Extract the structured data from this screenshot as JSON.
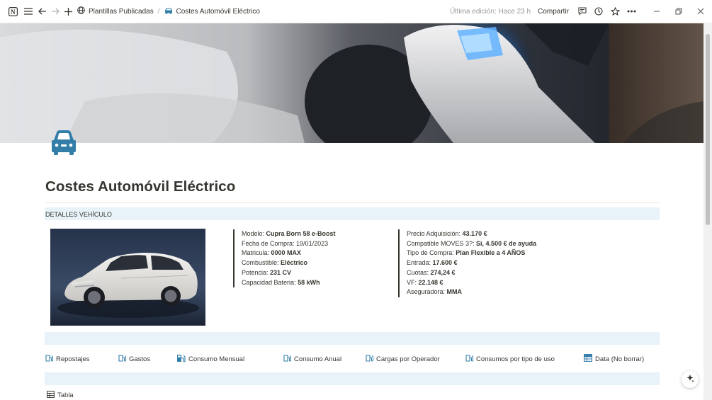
{
  "topbar": {
    "breadcrumb_parent": "Plantillas Publicadas",
    "breadcrumb_current": "Costes Automóvil Eléctrico",
    "last_edited": "Última edición: Hace 23 h",
    "share_label": "Compartir"
  },
  "page": {
    "title": "Costes Automóvil Eléctrico",
    "section_title": "DETALLES VEHÍCULO"
  },
  "vehicle": [
    {
      "label": "Modelo: ",
      "value": "Cupra Born 58 e-Boost"
    },
    {
      "label": "Fecha de Compra: ",
      "value": "19/01/2023"
    },
    {
      "label": "Matricula: ",
      "value": "0000 MAX"
    },
    {
      "label": "Combustible: ",
      "value": "Eléctrico"
    },
    {
      "label": "Potencia: ",
      "value": "231 CV"
    },
    {
      "label": "Capacidad Bateria: ",
      "value": "58 kWh"
    }
  ],
  "finance": [
    {
      "label": "Precio Adquisición: ",
      "value": "43.170 €"
    },
    {
      "label": "Compatible MOVES 3?: ",
      "value": "Si, 4.500 € de ayuda"
    },
    {
      "label": "Tipo de Compra: ",
      "value": "Plan Flexible a 4 AÑOS"
    },
    {
      "label": "Entrada: ",
      "value": "17.600 €"
    },
    {
      "label": "Cuotas: ",
      "value": "274,24 €"
    },
    {
      "label": "VF: ",
      "value": "22.148 €"
    },
    {
      "label": "Aseguradora: ",
      "value": "MMA"
    }
  ],
  "tabs": [
    {
      "label": "Repostajes",
      "icon": "gas-pump-icon"
    },
    {
      "label": "Gastos",
      "icon": "gas-pump-icon"
    },
    {
      "label": "Consumo Mensual",
      "icon": "gas-station-icon"
    },
    {
      "label": "Consumo Anual",
      "icon": "gas-pump-icon"
    },
    {
      "label": "Cargas por Operador",
      "icon": "gas-pump-icon"
    },
    {
      "label": "Consumos por tipo de uso",
      "icon": "gas-pump-icon"
    },
    {
      "label": "Data (No borrar)",
      "icon": "table-icon"
    }
  ],
  "bottom_view_label": "Tabla",
  "colors": {
    "accent_icon": "#337ea9",
    "band": "#e7f3f8",
    "text": "#37352f"
  }
}
